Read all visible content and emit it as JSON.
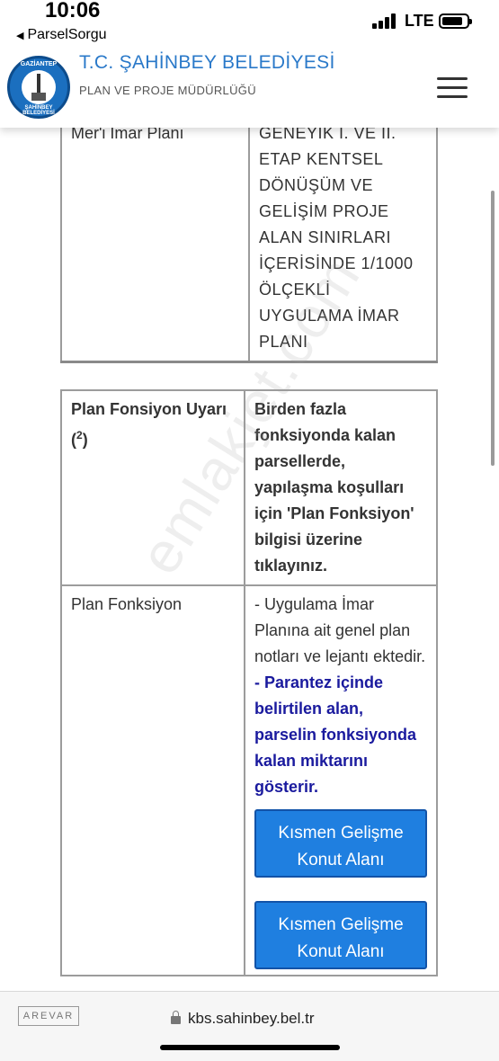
{
  "status_bar": {
    "time": "10:06",
    "back_label": "ParselSorgu",
    "network": "LTE"
  },
  "header": {
    "title": "T.C. ŞAHİNBEY BELEDİYESİ",
    "subtitle": "PLAN VE PROJE MÜDÜRLÜĞÜ",
    "logo_top": "GAZİANTEP",
    "logo_bottom": "ŞAHİNBEY BELEDİYESİ"
  },
  "rows": {
    "meri_imar": {
      "label": "Mer'i İmar Planı",
      "value": "GENEYİK I. VE II. ETAP KENTSEL DÖNÜŞÜM VE GELİŞİM PROJE ALAN SINIRLARI İÇERİSİNDE 1/1000 ÖLÇEKLİ UYGULAMA İMAR PLANI"
    },
    "uyari": {
      "label": "Plan Fonsiyon Uyarı (",
      "label_sup": "2",
      "label_end": ")",
      "value": "Birden fazla fonksiyonda kalan parsellerde, yapılaşma koşulları için 'Plan Fonksiyon' bilgisi üzerine tıklayınız."
    },
    "fonksiyon": {
      "label": "Plan Fonksiyon",
      "note": "- Uygulama İmar Planına ait genel plan notları ve lejantı ektedir.",
      "note_bold": "- Parantez içinde belirtilen alan, parselin fonksiyonda kalan miktarını gösterir.",
      "buttons": [
        "Kısmen Gelişme Konut Alanı",
        "Kısmen Gelişme Konut Alanı"
      ]
    }
  },
  "watermark": "emlakjet.com",
  "bottom_bar": {
    "brand": "AREVAR",
    "url": "kbs.sahinbey.bel.tr"
  },
  "colors": {
    "header_blue": "#2a79c9",
    "warning_red": "#d0021b",
    "note_navy": "#1a1a9e",
    "button_blue": "#1f7fe0"
  }
}
